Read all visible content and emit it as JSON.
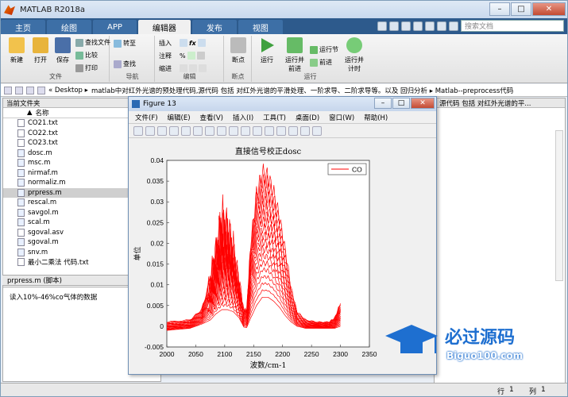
{
  "window": {
    "title": "MATLAB R2018a"
  },
  "tabs": [
    "主页",
    "绘图",
    "APP",
    "编辑器",
    "发布",
    "视图"
  ],
  "search_placeholder": "搜索文档",
  "ribbon": {
    "file_group": "文件",
    "nav_group": "导航",
    "edit_group": "编辑",
    "break_group": "断点",
    "run_group": "运行",
    "new": "新建",
    "open": "打开",
    "save": "保存",
    "find_files": "查找文件",
    "compare": "比较",
    "print": "打印",
    "goto": "转至",
    "find": "查找",
    "insert": "插入",
    "comment": "注释",
    "indent": "缩进",
    "breakpoints": "断点",
    "run": "运行",
    "run_advance": "运行并\n前进",
    "run_section": "运行节",
    "advance": "前进",
    "run_time": "运行并\n计时"
  },
  "address": "matlab中对红外光谱的预处理代码,源代码 包括 对红外光谱的平滑处理、一阶求导、二阶求导等。以及 回归分析 ▸ Matlab--preprocess代码",
  "address_root": "« Desktop ▸",
  "left_panel": {
    "title": "当前文件夹",
    "col_name": "名称",
    "files": [
      "CO21.txt",
      "CO22.txt",
      "CO23.txt",
      "dosc.m",
      "msc.m",
      "nirmaf.m",
      "normaliz.m",
      "prpress.m",
      "rescal.m",
      "savgol.m",
      "scal.m",
      "sgoval.asv",
      "sgoval.m",
      "snv.m",
      "最小二乘法 代码.txt"
    ],
    "selected": "prpress.m"
  },
  "detail": {
    "title": "prpress.m  (脚本)",
    "body": "读入10%-46%co气体的数据"
  },
  "right_panel": {
    "title": "源代码 包括 对红外光谱的平..."
  },
  "status": {
    "row_label": "行",
    "row": "1",
    "col_label": "列",
    "col": "1"
  },
  "figure": {
    "title": "Figure 13",
    "menus": [
      "文件(F)",
      "编辑(E)",
      "查看(V)",
      "插入(I)",
      "工具(T)",
      "桌面(D)",
      "窗口(W)",
      "帮助(H)"
    ]
  },
  "watermark": {
    "brand": "必过源码",
    "url": "Biguo100.com"
  },
  "chart_data": {
    "type": "line",
    "title": "直接信号校正dosc",
    "xlabel": "波数/cm-1",
    "ylabel": "单位",
    "xlim": [
      2000,
      2350
    ],
    "ylim": [
      -0.005,
      0.04
    ],
    "xticks": [
      2000,
      2050,
      2100,
      2150,
      2200,
      2250,
      2300,
      2350
    ],
    "yticks": [
      -0.005,
      0,
      0.005,
      0.01,
      0.015,
      0.02,
      0.025,
      0.03,
      0.035,
      0.04
    ],
    "legend": {
      "label": "CO",
      "position": "top-right"
    },
    "series_color": "#ff0000",
    "envelope": {
      "x": [
        2000,
        2040,
        2060,
        2075,
        2085,
        2095,
        2105,
        2115,
        2125,
        2133,
        2138,
        2145,
        2155,
        2165,
        2175,
        2185,
        2195,
        2205,
        2215,
        2225,
        2240,
        2260,
        2280,
        2290,
        2300
      ],
      "upper": [
        0.001,
        0.0015,
        0.004,
        0.011,
        0.0175,
        0.025,
        0.0225,
        0.018,
        0.01,
        0.004,
        0.004,
        0.02,
        0.032,
        0.037,
        0.036,
        0.032,
        0.026,
        0.018,
        0.009,
        0.0035,
        0.0015,
        0.001,
        0.001,
        0.002,
        0.0055
      ],
      "lower": [
        -0.001,
        -0.0005,
        0.0005,
        0.0015,
        0.003,
        0.004,
        0.004,
        0.0035,
        0.002,
        -0.0002,
        -0.0003,
        0.002,
        0.005,
        0.007,
        0.007,
        0.006,
        0.0045,
        0.0025,
        0.001,
        0.0,
        -0.0005,
        -0.0005,
        -0.0005,
        -0.0005,
        0.0
      ]
    },
    "curve_count": 19
  }
}
